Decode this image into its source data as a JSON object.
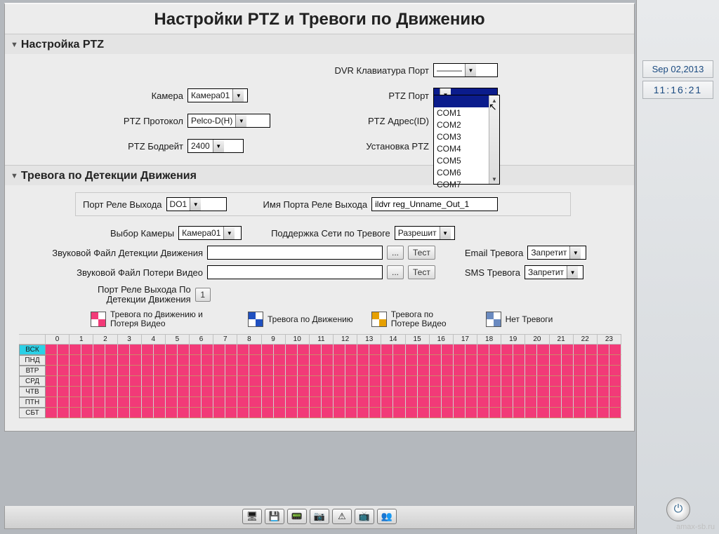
{
  "title": "Настройки PTZ и Тревоги по Движению",
  "sections": {
    "ptz_title": "Настройка PTZ",
    "motion_title": "Тревога по Детекции Движения"
  },
  "ptz": {
    "camera_label": "Камера",
    "camera_value": "Камера01",
    "protocol_label": "PTZ Протокол",
    "protocol_value": "Pelco-D(H)",
    "baud_label": "PTZ Бодрейт",
    "baud_value": "2400",
    "dvr_kb_label": "DVR Клавиатура Порт",
    "dvr_kb_value": "———",
    "ptz_port_label": "PTZ Порт",
    "ptz_port_value": "",
    "ptz_addr_label": "PTZ Адрес(ID)",
    "ptz_install_label": "Установка PTZ",
    "port_options": [
      "COM1",
      "COM2",
      "COM3",
      "COM4",
      "COM5",
      "COM6",
      "COM7"
    ]
  },
  "motion": {
    "relay_port_label": "Порт Реле Выхода",
    "relay_port_value": "DO1",
    "relay_name_label": "Имя Порта Реле Выхода",
    "relay_name_value": "ildvr reg_Unname_Out_1",
    "cam_sel_label": "Выбор Камеры",
    "cam_sel_value": "Камера01",
    "net_support_label": "Поддержка Сети по Тревоге",
    "net_support_value": "Разрешит",
    "sound_motion_label": "Звуковой Файл Детекции Движения",
    "sound_loss_label": "Звуковой Файл Потери Видео",
    "browse": "...",
    "test": "Тест",
    "email_label": "Email Тревога",
    "email_value": "Запретит",
    "sms_label": "SMS Тревога",
    "sms_value": "Запретит",
    "relay_by_motion_label_l1": "Порт Реле Выхода По",
    "relay_by_motion_label_l2": "Детекции Движения",
    "relay_by_motion_value": "1"
  },
  "legend": {
    "both": "Тревога по Движению и Потеря Видео",
    "motion": "Тревога по Движению",
    "loss_l1": "Тревога по",
    "loss_l2": "Потере Видео",
    "none": "Нет Тревоги"
  },
  "schedule": {
    "hours": [
      "0",
      "1",
      "2",
      "3",
      "4",
      "5",
      "6",
      "7",
      "8",
      "9",
      "10",
      "11",
      "12",
      "13",
      "14",
      "15",
      "16",
      "17",
      "18",
      "19",
      "20",
      "21",
      "22",
      "23"
    ],
    "days": [
      "ВСК",
      "ПНД",
      "ВТР",
      "СРД",
      "ЧТВ",
      "ПТН",
      "СБТ"
    ],
    "selected_day_index": 0
  },
  "sidebar": {
    "date": "Sep 02,2013",
    "time": "11:16:21"
  },
  "watermark": "amax-sb.ru"
}
